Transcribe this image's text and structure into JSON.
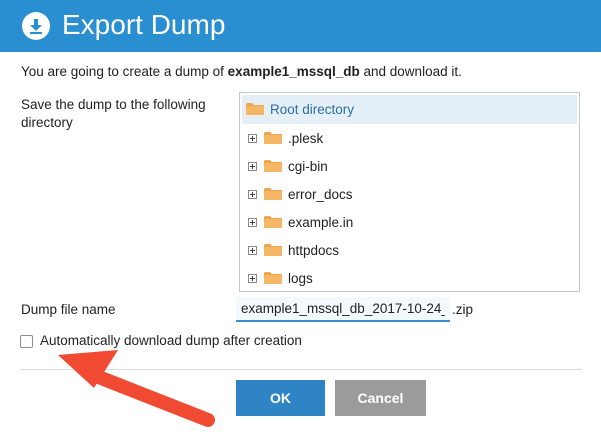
{
  "dialog": {
    "title": "Export Dump",
    "header_icon": "download-icon",
    "intro_prefix": "You are going to create a dump of",
    "database_name": "example1_mssql_db",
    "intro_suffix": "and download it.",
    "directory_label": "Save the dump to the following directory"
  },
  "tree": {
    "root": {
      "label": "Root directory",
      "icon": "folder-icon"
    },
    "items": [
      {
        "label": ".plesk",
        "icon": "folder-icon"
      },
      {
        "label": "cgi-bin",
        "icon": "folder-icon"
      },
      {
        "label": "error_docs",
        "icon": "folder-icon"
      },
      {
        "label": "example.in",
        "icon": "folder-icon"
      },
      {
        "label": "httpdocs",
        "icon": "folder-icon"
      },
      {
        "label": "logs",
        "icon": "folder-icon"
      }
    ]
  },
  "file": {
    "label": "Dump file name",
    "value": "example1_mssql_db_2017-10-24_",
    "extension": ".zip"
  },
  "auto_download": {
    "label": "Automatically download dump after creation",
    "checked": false
  },
  "buttons": {
    "ok": "OK",
    "cancel": "Cancel"
  },
  "colors": {
    "header": "#2a8fd1",
    "ok_button": "#2f84c6",
    "cancel_button": "#9b9b9b",
    "selection": "#e4eff7",
    "folder": "#f0a64c",
    "annotation_arrow": "#f14a33"
  }
}
